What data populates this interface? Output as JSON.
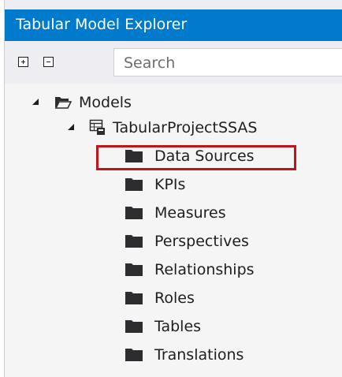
{
  "panel": {
    "title": "Tabular Model Explorer"
  },
  "toolbar": {
    "expand_all_icon": "plus-box-icon",
    "collapse_all_icon": "minus-box-icon",
    "search_placeholder": "Search"
  },
  "tree": {
    "root": {
      "label": "Models",
      "icon": "open-folder-icon",
      "expanded": true
    },
    "project": {
      "label": "TabularProjectSSAS",
      "icon": "tabular-model-icon",
      "expanded": true
    },
    "children": [
      {
        "label": "Data Sources",
        "icon": "folder-icon",
        "highlighted": true
      },
      {
        "label": "KPIs",
        "icon": "folder-icon"
      },
      {
        "label": "Measures",
        "icon": "folder-icon"
      },
      {
        "label": "Perspectives",
        "icon": "folder-icon"
      },
      {
        "label": "Relationships",
        "icon": "folder-icon"
      },
      {
        "label": "Roles",
        "icon": "folder-icon"
      },
      {
        "label": "Tables",
        "icon": "folder-icon"
      },
      {
        "label": "Translations",
        "icon": "folder-icon"
      }
    ]
  },
  "colors": {
    "title_bar": "#007acc",
    "highlight_box": "#c0141d",
    "folder": "#2d2d30"
  }
}
